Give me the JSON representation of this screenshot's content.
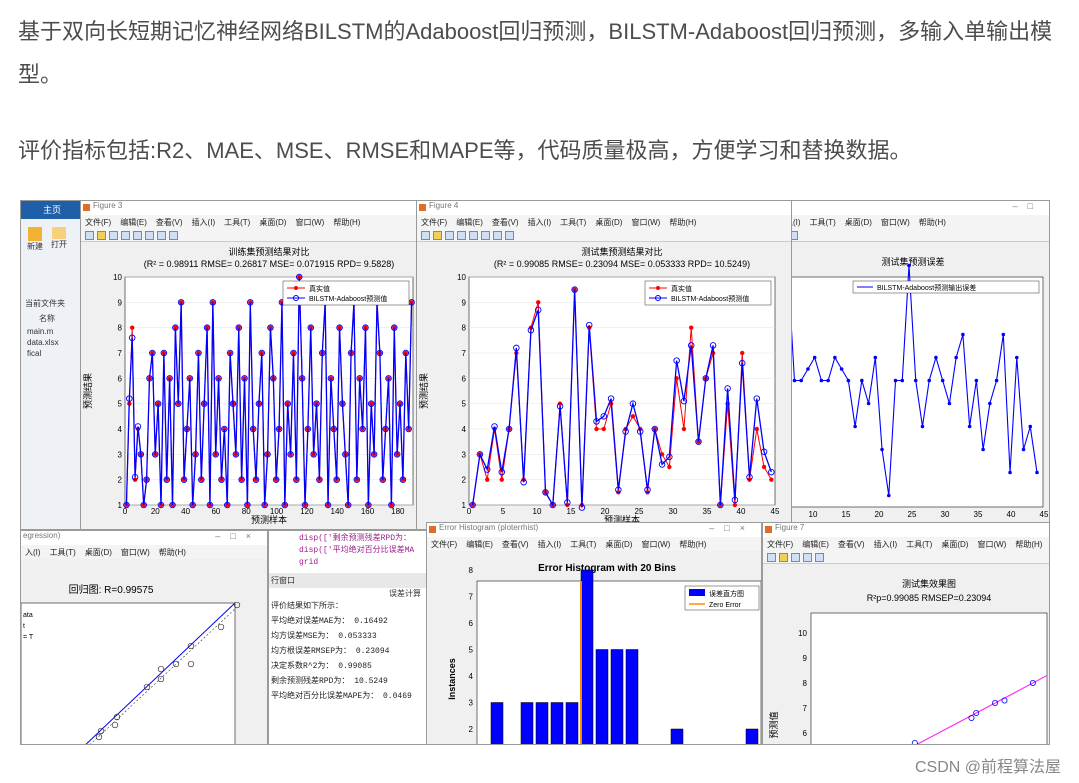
{
  "intro": {
    "line1": "基于双向长短期记忆神经网络BILSTM的Adaboost回归预测，BILSTM-Adaboost回归预测，多输入单输出模型。",
    "line2": "评价指标包括:R2、MAE、MSE、RMSE和MAPE等，代码质量极高，方便学习和替换数据。"
  },
  "matlab_left": {
    "tab": "主页",
    "btn_new": "新建",
    "btn_open": "打开",
    "folder_label": "当前文件夹",
    "col_name": "名称",
    "files": [
      "main.m",
      "data.xlsx",
      "fical"
    ]
  },
  "menu": [
    "文件(F)",
    "编辑(E)",
    "查看(V)",
    "插入(I)",
    "工具(T)",
    "桌面(D)",
    "窗口(W)",
    "帮助(H)"
  ],
  "fig3": {
    "window_title": "Figure 3",
    "title": "训练集预测结果对比",
    "subtitle": "(R² = 0.98911 RMSE= 0.26817 MSE= 0.071915 RPD= 9.5828)",
    "xlabel": "预测样本",
    "ylabel": "预测结果",
    "legend": [
      "真实值",
      "BILSTM-Adaboost预测值"
    ],
    "yticks": [
      "1",
      "2",
      "3",
      "4",
      "5",
      "6",
      "7",
      "8",
      "9",
      "10"
    ],
    "xticks": [
      "0",
      "20",
      "40",
      "60",
      "80",
      "100",
      "120",
      "140",
      "160",
      "180"
    ]
  },
  "fig4": {
    "window_title": "Figure 4",
    "title": "测试集预测结果对比",
    "subtitle": "(R² = 0.99085 RMSE= 0.23094 MSE= 0.053333 RPD= 10.5249)",
    "xlabel": "预测样本",
    "ylabel": "预测结果",
    "legend": [
      "真实值",
      "BILSTM-Adaboost预测值"
    ],
    "yticks": [
      "1",
      "2",
      "3",
      "4",
      "5",
      "6",
      "7",
      "8",
      "9",
      "10"
    ],
    "xticks": [
      "0",
      "5",
      "10",
      "15",
      "20",
      "25",
      "30",
      "35",
      "40",
      "45"
    ]
  },
  "fig5": {
    "title": "测试集预测误差",
    "legend": "BILSTM-Adaboost预测输出误差",
    "xticks": [
      "10",
      "15",
      "20",
      "25",
      "30",
      "35",
      "40",
      "45"
    ]
  },
  "regression": {
    "window_title": "egression)",
    "menu": [
      "入(I)",
      "工具(T)",
      "桌面(D)",
      "窗口(W)",
      "帮助(H)"
    ],
    "title": "回归图: R=0.99575",
    "legend_lines": [
      "ata",
      "t",
      "= T"
    ]
  },
  "console": {
    "code_lines": [
      "disp(['剩余预测残差RPD为：",
      "disp(['平均绝对百分比误差MA",
      "grid"
    ],
    "window_label": "行窗口",
    "box_title": "误差计算",
    "intro_line": "评价结果如下所示：",
    "rows": [
      {
        "label": "平均绝对误差MAE为：",
        "value": "0.16492"
      },
      {
        "label": "均方误差MSE为：",
        "value": "0.053333"
      },
      {
        "label": "均方根误差RMSEP为：",
        "value": "0.23094"
      },
      {
        "label": "决定系数R^2为：",
        "value": "0.99085"
      },
      {
        "label": "剩余预测残差RPD为：",
        "value": "10.5249"
      },
      {
        "label": "平均绝对百分比误差MAPE为：",
        "value": "0.0469"
      }
    ]
  },
  "hist": {
    "window_title": "Error Histogram (ploterrhist)",
    "title": "Error Histogram with 20 Bins",
    "ylabel": "Instances",
    "legend": [
      "误差直方图",
      "Zero Error"
    ],
    "yticks": [
      "2",
      "3",
      "4",
      "5",
      "6",
      "7",
      "8"
    ]
  },
  "fig7": {
    "window_title": "Figure 7",
    "title": "测试集效果图",
    "subtitle": "R²p=0.99085  RMSEP=0.23094",
    "ylabel": "预测值",
    "yticks": [
      "4",
      "5",
      "6",
      "7",
      "8",
      "9",
      "10"
    ]
  },
  "watermark": "CSDN @前程算法屋",
  "colors": {
    "blue": "#0000ff",
    "red": "#ff0000",
    "orange": "#ff8c00",
    "magenta": "#ff33ff"
  },
  "chart_data": [
    {
      "type": "line",
      "title": "训练集预测结果对比",
      "xlabel": "预测样本",
      "ylabel": "预测结果",
      "xlim": [
        0,
        190
      ],
      "ylim": [
        1,
        10
      ],
      "series": [
        {
          "name": "真实值",
          "values": [
            1,
            5,
            8,
            2,
            4,
            3,
            1,
            2,
            6,
            7,
            3,
            5,
            1,
            7,
            2,
            6,
            1,
            8,
            5,
            9,
            2,
            4,
            6,
            1,
            3,
            7,
            2,
            5,
            8,
            1,
            9,
            3,
            6,
            2,
            4,
            1,
            7,
            5,
            3,
            8,
            2,
            6,
            1,
            9,
            4,
            2,
            5,
            7,
            1,
            3,
            8,
            6,
            2,
            4,
            9,
            1,
            5,
            3,
            7,
            2,
            10,
            6,
            1,
            4,
            8,
            3,
            5,
            2,
            7,
            9,
            1,
            6,
            4,
            2,
            8,
            5,
            3,
            1,
            7,
            9,
            2,
            6,
            4,
            8,
            1,
            5,
            3,
            9,
            7,
            2,
            4,
            6,
            1,
            8,
            3,
            5,
            2,
            7,
            4,
            9
          ]
        },
        {
          "name": "BILSTM-Adaboost预测值",
          "values": [
            1,
            5.2,
            7.6,
            2.1,
            4.1,
            3,
            1,
            2,
            6,
            7,
            3,
            5,
            1,
            7,
            2,
            6,
            1,
            8,
            5,
            9,
            2,
            4,
            6,
            1,
            3,
            7,
            2,
            5,
            8,
            1,
            9,
            3,
            6,
            2,
            4,
            1,
            7,
            5,
            3,
            8,
            2,
            6,
            1,
            9,
            4,
            2,
            5,
            7,
            1,
            3,
            8,
            6,
            2,
            4,
            9,
            1,
            5,
            3,
            7,
            2,
            10,
            6,
            1,
            4,
            8,
            3,
            5,
            2,
            7,
            9,
            1,
            6,
            4,
            2,
            8,
            5,
            3,
            1,
            7,
            9,
            2,
            6,
            4,
            8,
            1,
            5,
            3,
            9,
            7,
            2,
            4,
            6,
            1,
            8,
            3,
            5,
            2,
            7,
            4,
            9
          ]
        }
      ]
    },
    {
      "type": "line",
      "title": "测试集预测结果对比",
      "xlabel": "预测样本",
      "ylabel": "预测结果",
      "xlim": [
        0,
        45
      ],
      "ylim": [
        1,
        10
      ],
      "series": [
        {
          "name": "真实值",
          "values": [
            1,
            3,
            2,
            4,
            2,
            4,
            7,
            2,
            8,
            9,
            1.5,
            1,
            5,
            1,
            9.5,
            1,
            8,
            4,
            4,
            5,
            1.5,
            4,
            4.5,
            4,
            1.5,
            4,
            3,
            2.5,
            6,
            4,
            8,
            3.5,
            6,
            7,
            1,
            5,
            1,
            7,
            2,
            4,
            2.5,
            2
          ]
        },
        {
          "name": "BILSTM-Adaboost预测值",
          "values": [
            1,
            3,
            2.4,
            4.1,
            2.3,
            4,
            7.2,
            1.9,
            7.9,
            8.7,
            1.5,
            1,
            4.9,
            1.1,
            9.5,
            0.9,
            8.1,
            4.3,
            4.5,
            5.2,
            1.6,
            3.9,
            5,
            3.9,
            1.6,
            4,
            2.6,
            2.9,
            6.7,
            5.1,
            7.3,
            3.5,
            6,
            7.3,
            1,
            5.6,
            1.2,
            6.6,
            2.1,
            5.2,
            3.1,
            2.3
          ]
        }
      ]
    },
    {
      "type": "line",
      "title": "测试集预测误差",
      "series": [
        {
          "name": "BILSTM-Adaboost预测输出误差",
          "values": [
            0.2,
            0.6,
            0.1,
            0.1,
            0.15,
            0.2,
            0.1,
            0.1,
            0.2,
            0.15,
            0.1,
            -0.1,
            0.1,
            0.0,
            0.2,
            -0.2,
            -0.4,
            0.1,
            0.1,
            0.6,
            0.1,
            -0.1,
            0.1,
            0.2,
            0.1,
            0.0,
            0.2,
            0.3,
            -0.1,
            0.1,
            -0.2,
            0.0,
            0.1,
            0.3,
            -0.3,
            0.2,
            -0.2,
            -0.1,
            -0.3
          ]
        }
      ]
    },
    {
      "type": "bar",
      "title": "Error Histogram with 20 Bins",
      "ylabel": "Instances",
      "values": [
        3,
        0,
        3,
        3,
        3,
        3,
        8,
        5,
        5,
        5,
        0,
        0,
        2,
        0,
        0,
        0,
        0,
        2
      ]
    },
    {
      "type": "scatter",
      "title": "测试集效果图",
      "ylabel": "预测值",
      "ylim": [
        4,
        10
      ],
      "x": [
        4,
        4,
        4.5,
        5,
        5,
        5.5,
        5.8,
        6.7,
        6.8,
        7.2,
        7.4,
        8
      ],
      "y": [
        4.3,
        4.1,
        4.6,
        5.1,
        5.0,
        5.6,
        5.2,
        6.6,
        6.8,
        7.2,
        7.3,
        8.0
      ]
    }
  ]
}
